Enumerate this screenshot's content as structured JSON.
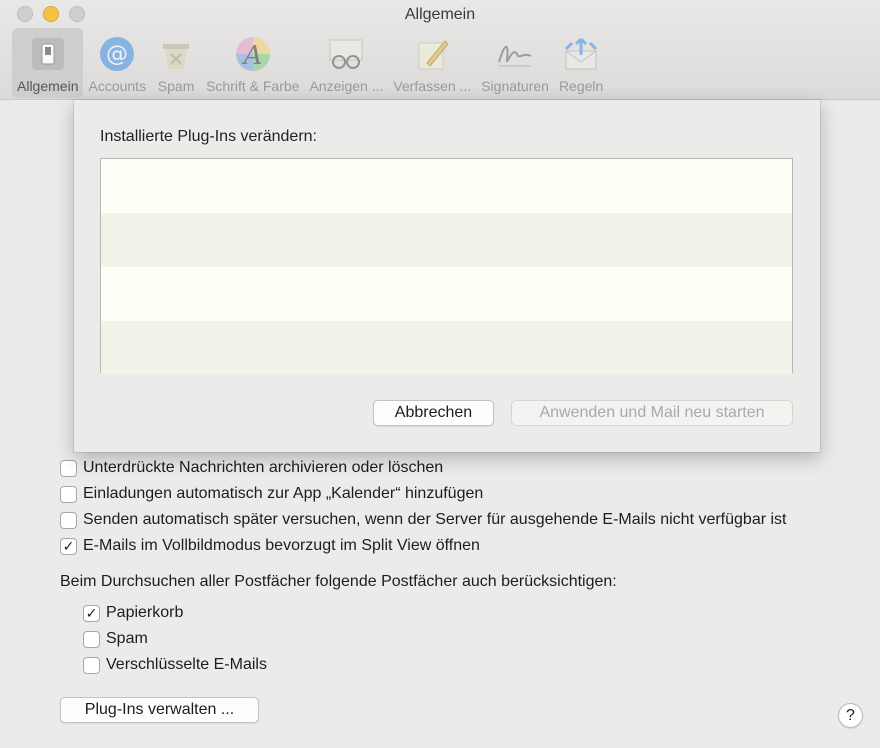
{
  "window": {
    "title": "Allgemein"
  },
  "toolbar": {
    "items": [
      {
        "label": "Allgemein",
        "icon": "switch-icon",
        "active": true
      },
      {
        "label": "Accounts",
        "icon": "at-sign-icon"
      },
      {
        "label": "Spam",
        "icon": "trash-bin-icon"
      },
      {
        "label": "Schrift & Farbe",
        "icon": "font-color-icon"
      },
      {
        "label": "Anzeigen ...",
        "icon": "glasses-icon"
      },
      {
        "label": "Verfassen ...",
        "icon": "pencil-paper-icon"
      },
      {
        "label": "Signaturen",
        "icon": "signature-icon"
      },
      {
        "label": "Regeln",
        "icon": "rules-envelope-icon"
      }
    ]
  },
  "sheet": {
    "title": "Installierte Plug-Ins verändern:",
    "cancel_label": "Abbrechen",
    "apply_label": "Anwenden und Mail neu starten"
  },
  "options": [
    {
      "label": "Unterdrückte Nachrichten archivieren oder löschen",
      "checked": false
    },
    {
      "label": "Einladungen automatisch zur App „Kalender“ hinzufügen",
      "checked": false
    },
    {
      "label": "Senden automatisch später versuchen, wenn der Server für ausgehende E-Mails nicht verfügbar ist",
      "checked": false
    },
    {
      "label": "E-Mails im Vollbildmodus bevorzugt im Split View öffnen",
      "checked": true
    }
  ],
  "search_section": {
    "label": "Beim Durchsuchen aller Postfächer folgende Postfächer auch berücksichtigen:",
    "items": [
      {
        "label": "Papierkorb",
        "checked": true
      },
      {
        "label": "Spam",
        "checked": false
      },
      {
        "label": "Verschlüsselte E-Mails",
        "checked": false
      }
    ]
  },
  "manage_plugins_label": "Plug-Ins verwalten ...",
  "help_label": "?",
  "check_glyph": "✓"
}
